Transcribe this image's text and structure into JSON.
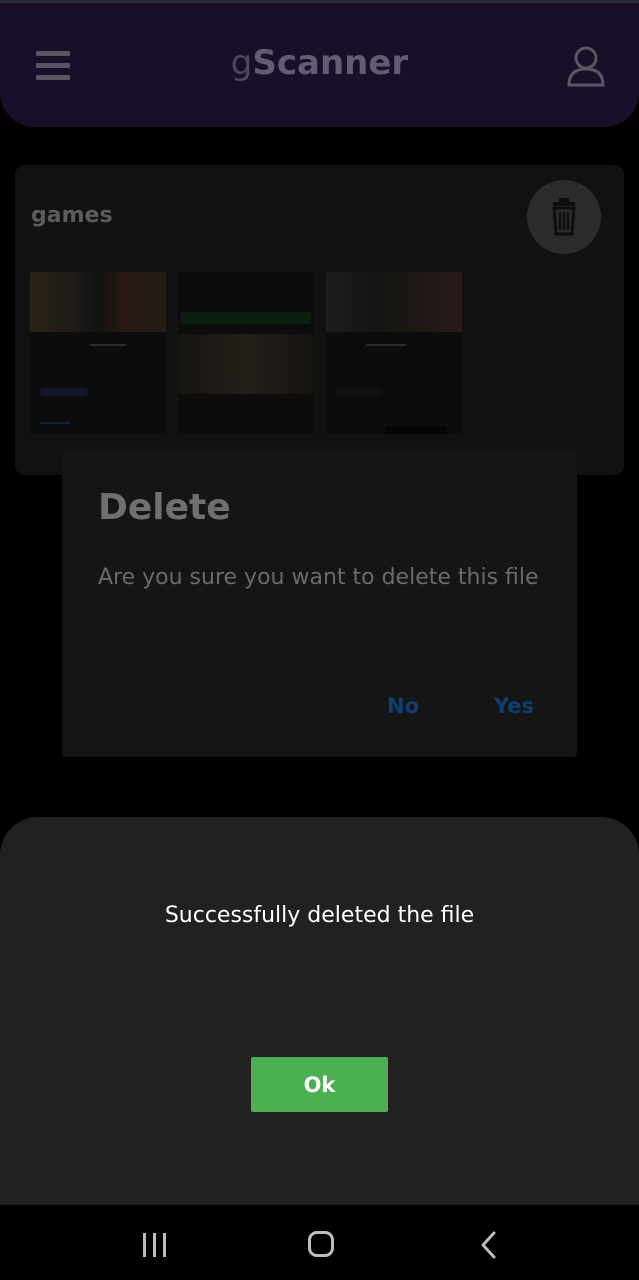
{
  "header": {
    "title_prefix": "g",
    "title_main": "Scanner",
    "menu_icon": "hamburger-icon",
    "user_icon": "user-icon"
  },
  "card": {
    "title": "games",
    "delete_icon": "trash-icon"
  },
  "dialog": {
    "title": "Delete",
    "message": "Are you sure you want to delete this file",
    "no_label": "No",
    "yes_label": "Yes"
  },
  "sheet": {
    "message": "Successfully deleted the file",
    "ok_label": "Ok"
  },
  "colors": {
    "ok_button": "#4caf50",
    "dialog_action": "#0d3f73",
    "header_bg": "#1a0f2b"
  },
  "navbar": {
    "recent_icon": "recent-apps-icon",
    "home_icon": "home-icon",
    "back_icon": "back-icon"
  }
}
